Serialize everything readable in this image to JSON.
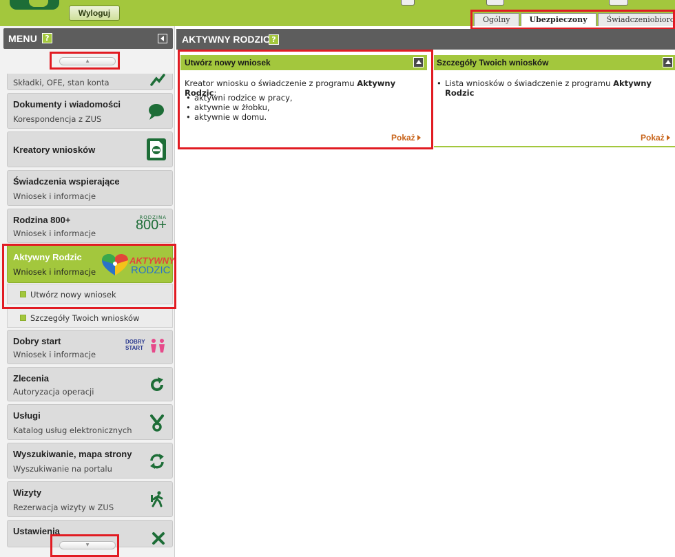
{
  "header": {
    "logout_label": "Wyloguj",
    "tabs": [
      {
        "label": "Ogólny",
        "active": false
      },
      {
        "label": "Ubezpieczony",
        "active": true
      },
      {
        "label": "Świadczeniobiorca",
        "active": false
      }
    ]
  },
  "sidebar": {
    "title": "MENU",
    "help_label": "?",
    "items": [
      {
        "title": "",
        "subtitle": "Składki, OFE, stan konta",
        "icon": "chart-trend-icon"
      },
      {
        "title": "Dokumenty i wiadomości",
        "subtitle": "Korespondencja z ZUS",
        "icon": "speech-bubble-icon"
      },
      {
        "title": "Kreatory wniosków",
        "subtitle": "",
        "icon": "document-form-icon"
      },
      {
        "title": "Świadczenia wspierające",
        "subtitle": "Wniosek i informacje",
        "icon": ""
      },
      {
        "title": "Rodzina 800+",
        "subtitle": "Wniosek i informacje",
        "icon": "rodzina-800-logo",
        "logo_small": "RODZINA",
        "logo_big": "800+"
      },
      {
        "title": "Aktywny Rodzic",
        "subtitle": "Wniosek i informacje",
        "icon": "aktywny-rodzic-logo",
        "logo_line1": "AKTYWNY",
        "logo_line2": "RODZIC",
        "active": true
      },
      {
        "title": "Dobry start",
        "subtitle": "Wniosek i informacje",
        "icon": "dobry-start-logo",
        "logo_line1": "DOBRY",
        "logo_line2": "START"
      },
      {
        "title": "Zlecenia",
        "subtitle": "Autoryzacja operacji",
        "icon": "refresh-arrow-icon"
      },
      {
        "title": "Usługi",
        "subtitle": "Katalog usług elektronicznych",
        "icon": "services-branch-icon"
      },
      {
        "title": "Wyszukiwanie, mapa strony",
        "subtitle": "Wyszukiwanie na portalu",
        "icon": "sync-arrows-icon"
      },
      {
        "title": "Wizyty",
        "subtitle": "Rezerwacja wizyty w ZUS",
        "icon": "walking-person-icon"
      },
      {
        "title": "Ustawienia",
        "subtitle": "",
        "icon": "settings-icon"
      }
    ],
    "subitems": [
      {
        "label": "Utwórz nowy wniosek"
      },
      {
        "label": "Szczegóły Twoich wniosków"
      }
    ]
  },
  "main": {
    "title": "AKTYWNY RODZIC",
    "help_label": "?",
    "panels": [
      {
        "title": "Utwórz nowy wniosek",
        "intro": "Kreator wniosku o świadczenie z programu ",
        "intro_bold": "Aktywny Rodzic",
        "intro_end": ":",
        "bullets": [
          "aktywni rodzice w pracy,",
          "aktywnie w żłobku,",
          "aktywnie w domu."
        ],
        "link_label": "Pokaż"
      },
      {
        "title": "Szczegóły Twoich wniosków",
        "bullet_text": "Lista wniosków o świadczenie z programu ",
        "bullet_bold": "Aktywny Rodzic",
        "link_label": "Pokaż"
      }
    ]
  },
  "colors": {
    "brand_green": "#a3c73d",
    "header_gray": "#5d5d5d",
    "highlight_red": "#e11b22",
    "link_orange": "#c8641a"
  }
}
